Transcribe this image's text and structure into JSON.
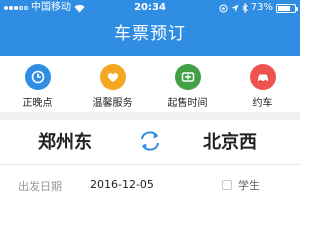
{
  "status_bar": {
    "carrier": "中国移动",
    "time": "20:34",
    "battery_percent": "73%",
    "battery_level": 0.73
  },
  "nav": {
    "title": "车票预订"
  },
  "shortcuts": [
    {
      "label": "正晚点",
      "icon": "clock-icon",
      "color": "#2f8ee4"
    },
    {
      "label": "温馨服务",
      "icon": "heart-icon",
      "color": "#f5a623"
    },
    {
      "label": "起售时间",
      "icon": "sale-time-icon",
      "color": "#43a047"
    },
    {
      "label": "约车",
      "icon": "car-icon",
      "color": "#ef5350"
    }
  ],
  "route": {
    "from": "郑州东",
    "to": "北京西"
  },
  "departure": {
    "label": "出发日期",
    "date": "2016-12-05"
  },
  "student": {
    "label": "学生"
  },
  "colors": {
    "accent": "#2f8ee4"
  }
}
